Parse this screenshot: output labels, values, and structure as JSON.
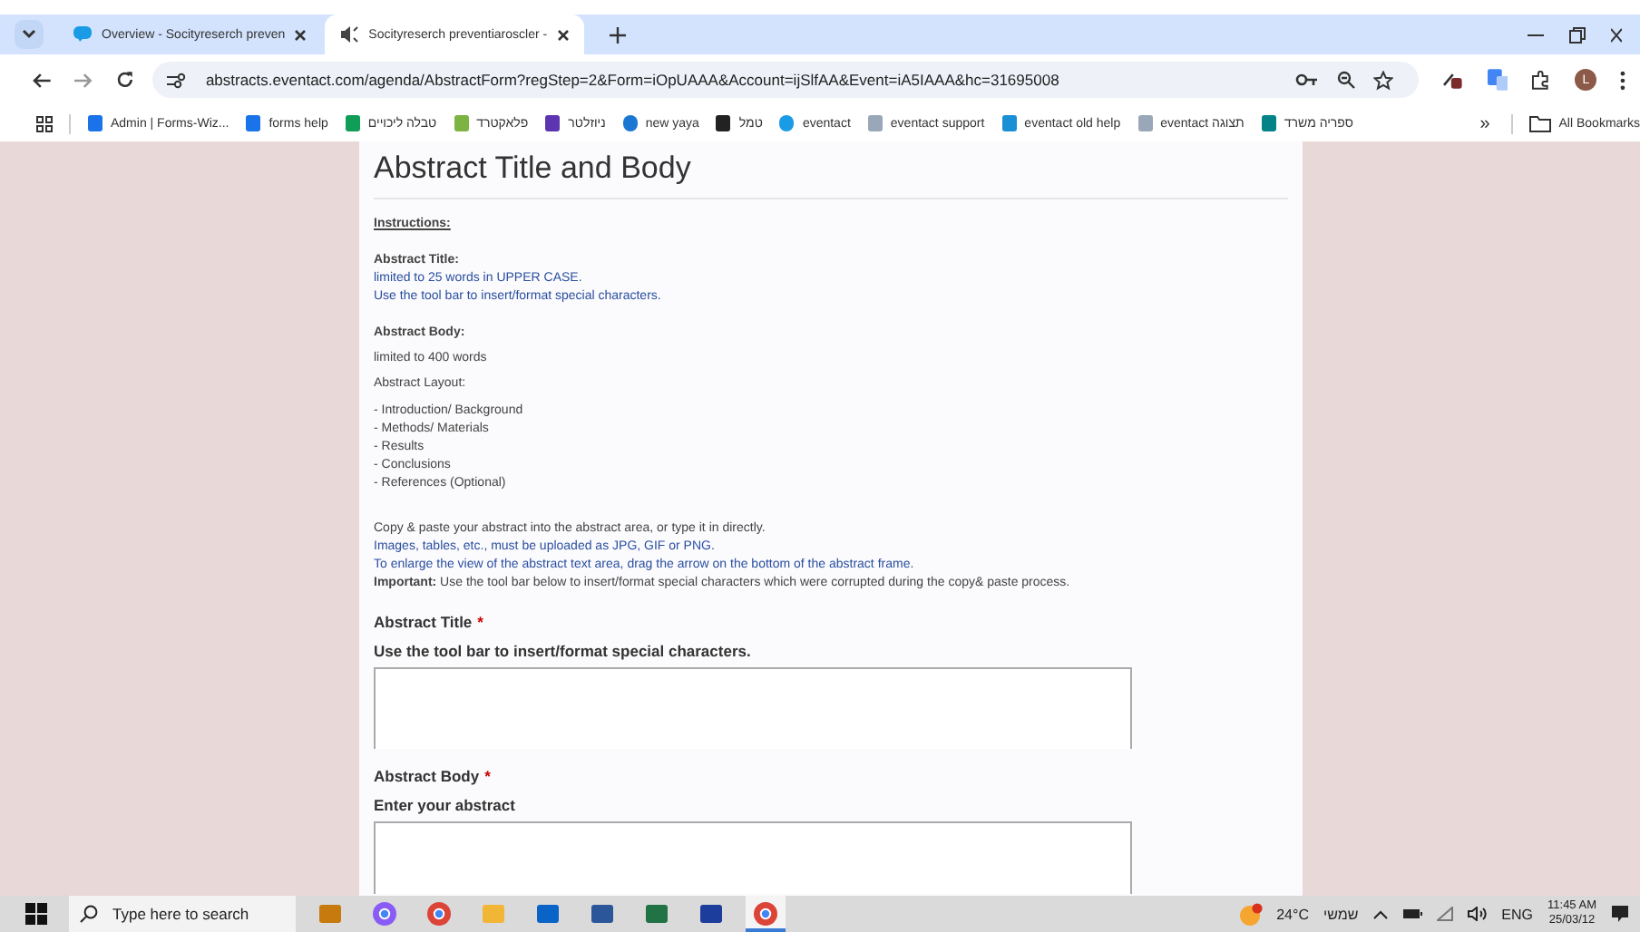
{
  "browser": {
    "tabs": [
      {
        "title": "Overview - Socityreserch preven",
        "selected": false,
        "kind": "chat"
      },
      {
        "title": "Socityreserch preventiaroscler -",
        "selected": true,
        "kind": "speaker"
      }
    ],
    "address": "abstracts.eventact.com/agenda/AbstractForm?regStep=2&Form=iOpUAAA&Account=ijSlfAA&Event=iA5IAAA&hc=31695008",
    "profile": "L",
    "bookmarks": [
      {
        "label": "Admin | Forms-Wiz...",
        "kind": "doc"
      },
      {
        "label": "forms help",
        "kind": "doc"
      },
      {
        "label": "טבלה ליכויים",
        "kind": "sheet"
      },
      {
        "label": "פלאקטרד",
        "kind": "leaf"
      },
      {
        "label": "ניוזלטר",
        "kind": "wave"
      },
      {
        "label": "new yaya",
        "kind": "globe"
      },
      {
        "label": "טמל",
        "kind": "ab"
      },
      {
        "label": "eventact",
        "kind": "chat"
      },
      {
        "label": "eventact support",
        "kind": "page"
      },
      {
        "label": "eventact old help",
        "kind": "monitor"
      },
      {
        "label": "eventact תצוגה",
        "kind": "page"
      },
      {
        "label": "ספריה משרד",
        "kind": "share"
      }
    ],
    "more": "»",
    "all_bookmarks": "All Bookmarks"
  },
  "page": {
    "heading": "Abstract Title and Body",
    "instructions_label": "Instructions:",
    "sections": [
      {
        "title": "Abstract Title:",
        "lines": [
          "limited to 25 words in UPPER CASE.",
          "Use the tool bar to insert/format special characters."
        ]
      },
      {
        "title": "Abstract Body:"
      }
    ],
    "body_limit": "limited to 400 words",
    "layout_label": "Abstract Layout:",
    "layout_items": [
      "- Introduction/ Background",
      "- Methods/ Materials",
      "- Results",
      "- Conclusions",
      "- References (Optional)"
    ],
    "notes": [
      "Copy & paste your abstract into the abstract area, or type it in directly.",
      "Images, tables, etc., must be uploaded as JPG, GIF or PNG.",
      "To enlarge the view of the abstract text area, drag the arrow on the bottom of the abstract frame.",
      "**Important:** Use the tool bar below to insert/format special characters which were corrupted during the copy& paste process."
    ],
    "fields": [
      {
        "label": "Abstract Title",
        "required_mark": "*",
        "hint": "Use the tool bar to insert/format special characters."
      },
      {
        "label": "Abstract Body",
        "required_mark": "*",
        "hint": "Enter your abstract"
      }
    ]
  },
  "taskbar": {
    "search_placeholder": "Type here to search",
    "apps": [
      {
        "kind": "briefcase",
        "active": false
      },
      {
        "kind": "copilot",
        "active": false
      },
      {
        "kind": "chrome",
        "active": false
      },
      {
        "kind": "folder",
        "active": false
      },
      {
        "kind": "outlook",
        "active": false
      },
      {
        "kind": "word",
        "active": false
      },
      {
        "kind": "excel",
        "active": false
      },
      {
        "kind": "lapp",
        "active": false
      },
      {
        "kind": "chrome",
        "active": true
      }
    ],
    "weather": "24°C",
    "weather_label": "שמשי",
    "language": "ENG",
    "time": "11:45 AM",
    "date": "25/03/12"
  }
}
